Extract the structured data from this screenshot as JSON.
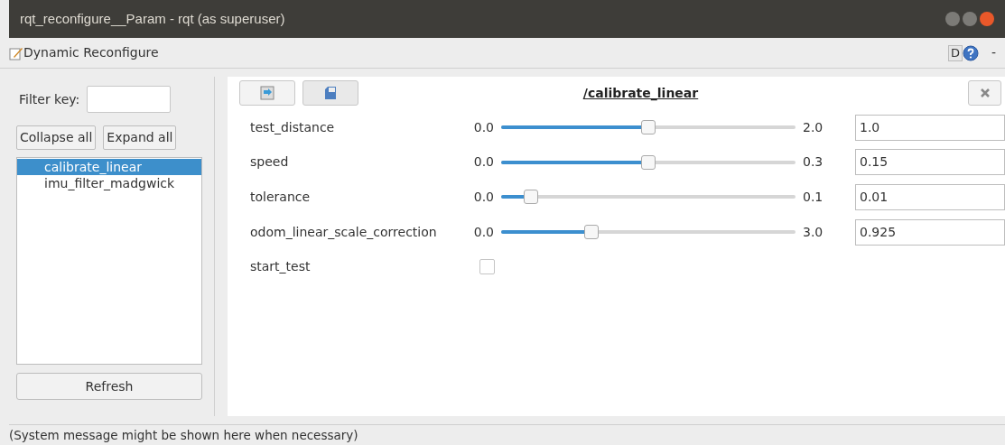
{
  "window": {
    "title": "rqt_reconfigure__Param - rqt (as superuser)"
  },
  "plugin": {
    "title": "Dynamic Reconfigure",
    "buttons": [
      "D",
      "-"
    ]
  },
  "filter": {
    "label": "Filter key:"
  },
  "tree_buttons": [
    "Collapse all",
    "Expand all"
  ],
  "nodes": [
    {
      "label": "calibrate_linear",
      "selected": true
    },
    {
      "label": "imu_filter_madgwick",
      "selected": false
    }
  ],
  "refresh": "Refresh",
  "panel": {
    "title": "/calibrate_linear"
  },
  "params": [
    {
      "kind": "slider",
      "name": "test_distance",
      "min": "0.0",
      "max": "2.0",
      "level": 0.5,
      "value": "1.0"
    },
    {
      "kind": "slider",
      "name": "speed",
      "min": "0.0",
      "max": "0.3",
      "level": 0.5,
      "value": "0.15"
    },
    {
      "kind": "slider",
      "name": "tolerance",
      "min": "0.0",
      "max": "0.1",
      "level": 0.1,
      "value": "0.01"
    },
    {
      "kind": "slider",
      "name": "odom_linear_scale_correction",
      "min": "0.0",
      "max": "3.0",
      "level": 0.308,
      "value": "0.925"
    },
    {
      "kind": "checkbox",
      "name": "start_test",
      "checked": false
    }
  ],
  "status_bar": "(System message might be shown here when necessary)"
}
